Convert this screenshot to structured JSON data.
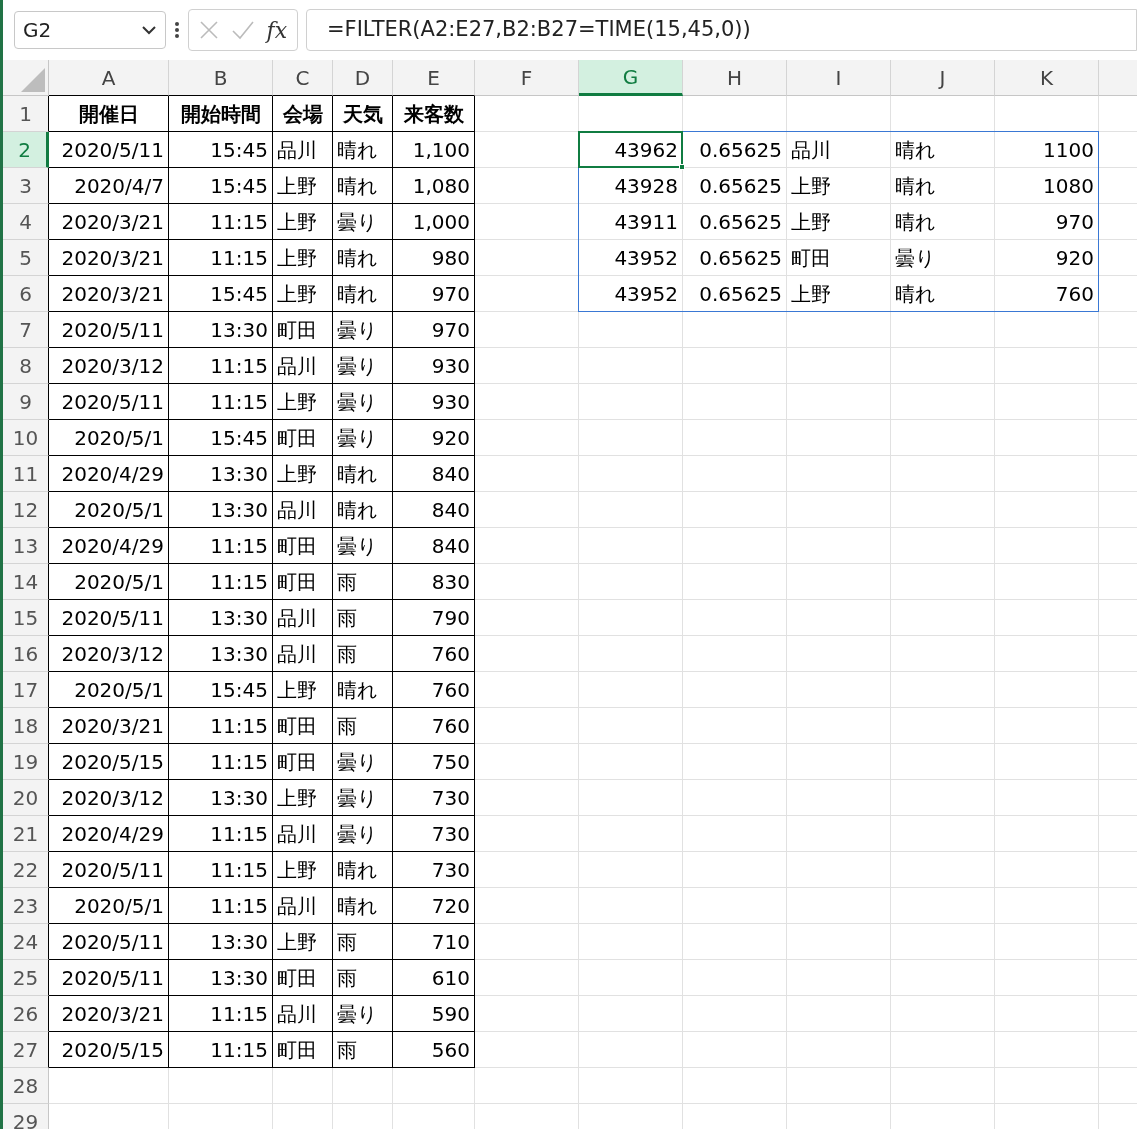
{
  "formula_bar": {
    "name_box": "G2",
    "fx": "fx",
    "formula": "=FILTER(A2:E27,B2:B27=TIME(15,45,0))"
  },
  "sheet": {
    "columns": [
      {
        "letter": "A",
        "kind": "number",
        "selected": false
      },
      {
        "letter": "B",
        "kind": "number",
        "selected": false
      },
      {
        "letter": "C",
        "kind": "text",
        "selected": false
      },
      {
        "letter": "D",
        "kind": "text",
        "selected": false
      },
      {
        "letter": "E",
        "kind": "number",
        "selected": false
      },
      {
        "letter": "F",
        "kind": "text",
        "selected": false
      },
      {
        "letter": "G",
        "kind": "number",
        "selected": true
      },
      {
        "letter": "H",
        "kind": "number",
        "selected": false
      },
      {
        "letter": "I",
        "kind": "text",
        "selected": false
      },
      {
        "letter": "J",
        "kind": "text",
        "selected": false
      },
      {
        "letter": "K",
        "kind": "number",
        "selected": false
      }
    ],
    "rows": [
      {
        "header": "1",
        "kind": "header",
        "selected": false,
        "cells": {
          "A": "開催日",
          "B": "開始時間",
          "C": "会場",
          "D": "天気",
          "E": "来客数"
        }
      },
      {
        "header": "2",
        "kind": "data",
        "selected": true,
        "cells": {
          "A": "2020/5/11",
          "B": "15:45",
          "C": "品川",
          "D": "晴れ",
          "E": "1,100",
          "G": "43962",
          "H": "0.65625",
          "I": "品川",
          "J": "晴れ",
          "K": "1100"
        }
      },
      {
        "header": "3",
        "kind": "data",
        "selected": false,
        "cells": {
          "A": "2020/4/7",
          "B": "15:45",
          "C": "上野",
          "D": "晴れ",
          "E": "1,080",
          "G": "43928",
          "H": "0.65625",
          "I": "上野",
          "J": "晴れ",
          "K": "1080"
        }
      },
      {
        "header": "4",
        "kind": "data",
        "selected": false,
        "cells": {
          "A": "2020/3/21",
          "B": "11:15",
          "C": "上野",
          "D": "曇り",
          "E": "1,000",
          "G": "43911",
          "H": "0.65625",
          "I": "上野",
          "J": "晴れ",
          "K": "970"
        }
      },
      {
        "header": "5",
        "kind": "data",
        "selected": false,
        "cells": {
          "A": "2020/3/21",
          "B": "11:15",
          "C": "上野",
          "D": "晴れ",
          "E": "980",
          "G": "43952",
          "H": "0.65625",
          "I": "町田",
          "J": "曇り",
          "K": "920"
        }
      },
      {
        "header": "6",
        "kind": "data",
        "selected": false,
        "cells": {
          "A": "2020/3/21",
          "B": "15:45",
          "C": "上野",
          "D": "晴れ",
          "E": "970",
          "G": "43952",
          "H": "0.65625",
          "I": "上野",
          "J": "晴れ",
          "K": "760"
        }
      },
      {
        "header": "7",
        "kind": "data",
        "selected": false,
        "cells": {
          "A": "2020/5/11",
          "B": "13:30",
          "C": "町田",
          "D": "曇り",
          "E": "970"
        }
      },
      {
        "header": "8",
        "kind": "data",
        "selected": false,
        "cells": {
          "A": "2020/3/12",
          "B": "11:15",
          "C": "品川",
          "D": "曇り",
          "E": "930"
        }
      },
      {
        "header": "9",
        "kind": "data",
        "selected": false,
        "cells": {
          "A": "2020/5/11",
          "B": "11:15",
          "C": "上野",
          "D": "曇り",
          "E": "930"
        }
      },
      {
        "header": "10",
        "kind": "data",
        "selected": false,
        "cells": {
          "A": "2020/5/1",
          "B": "15:45",
          "C": "町田",
          "D": "曇り",
          "E": "920"
        }
      },
      {
        "header": "11",
        "kind": "data",
        "selected": false,
        "cells": {
          "A": "2020/4/29",
          "B": "13:30",
          "C": "上野",
          "D": "晴れ",
          "E": "840"
        }
      },
      {
        "header": "12",
        "kind": "data",
        "selected": false,
        "cells": {
          "A": "2020/5/1",
          "B": "13:30",
          "C": "品川",
          "D": "晴れ",
          "E": "840"
        }
      },
      {
        "header": "13",
        "kind": "data",
        "selected": false,
        "cells": {
          "A": "2020/4/29",
          "B": "11:15",
          "C": "町田",
          "D": "曇り",
          "E": "840"
        }
      },
      {
        "header": "14",
        "kind": "data",
        "selected": false,
        "cells": {
          "A": "2020/5/1",
          "B": "11:15",
          "C": "町田",
          "D": "雨",
          "E": "830"
        }
      },
      {
        "header": "15",
        "kind": "data",
        "selected": false,
        "cells": {
          "A": "2020/5/11",
          "B": "13:30",
          "C": "品川",
          "D": "雨",
          "E": "790"
        }
      },
      {
        "header": "16",
        "kind": "data",
        "selected": false,
        "cells": {
          "A": "2020/3/12",
          "B": "13:30",
          "C": "品川",
          "D": "雨",
          "E": "760"
        }
      },
      {
        "header": "17",
        "kind": "data",
        "selected": false,
        "cells": {
          "A": "2020/5/1",
          "B": "15:45",
          "C": "上野",
          "D": "晴れ",
          "E": "760"
        }
      },
      {
        "header": "18",
        "kind": "data",
        "selected": false,
        "cells": {
          "A": "2020/3/21",
          "B": "11:15",
          "C": "町田",
          "D": "雨",
          "E": "760"
        }
      },
      {
        "header": "19",
        "kind": "data",
        "selected": false,
        "cells": {
          "A": "2020/5/15",
          "B": "11:15",
          "C": "町田",
          "D": "曇り",
          "E": "750"
        }
      },
      {
        "header": "20",
        "kind": "data",
        "selected": false,
        "cells": {
          "A": "2020/3/12",
          "B": "13:30",
          "C": "上野",
          "D": "曇り",
          "E": "730"
        }
      },
      {
        "header": "21",
        "kind": "data",
        "selected": false,
        "cells": {
          "A": "2020/4/29",
          "B": "11:15",
          "C": "品川",
          "D": "曇り",
          "E": "730"
        }
      },
      {
        "header": "22",
        "kind": "data",
        "selected": false,
        "cells": {
          "A": "2020/5/11",
          "B": "11:15",
          "C": "上野",
          "D": "晴れ",
          "E": "730"
        }
      },
      {
        "header": "23",
        "kind": "data",
        "selected": false,
        "cells": {
          "A": "2020/5/1",
          "B": "11:15",
          "C": "品川",
          "D": "晴れ",
          "E": "720"
        }
      },
      {
        "header": "24",
        "kind": "data",
        "selected": false,
        "cells": {
          "A": "2020/5/11",
          "B": "13:30",
          "C": "上野",
          "D": "雨",
          "E": "710"
        }
      },
      {
        "header": "25",
        "kind": "data",
        "selected": false,
        "cells": {
          "A": "2020/5/11",
          "B": "13:30",
          "C": "町田",
          "D": "雨",
          "E": "610"
        }
      },
      {
        "header": "26",
        "kind": "data",
        "selected": false,
        "cells": {
          "A": "2020/3/21",
          "B": "11:15",
          "C": "品川",
          "D": "曇り",
          "E": "590"
        }
      },
      {
        "header": "27",
        "kind": "data",
        "selected": false,
        "cells": {
          "A": "2020/5/15",
          "B": "11:15",
          "C": "町田",
          "D": "雨",
          "E": "560"
        }
      },
      {
        "header": "28",
        "kind": "empty",
        "selected": false,
        "cells": {}
      },
      {
        "header": "29",
        "kind": "empty",
        "selected": false,
        "cells": {}
      }
    ]
  }
}
